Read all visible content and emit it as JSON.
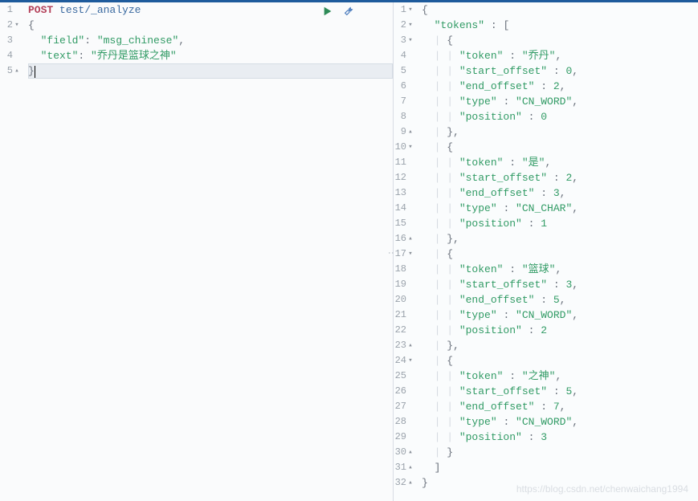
{
  "icons": {
    "run": "run-icon",
    "wrench": "wrench-icon"
  },
  "watermark": "https://blog.csdn.net/chenwaichang1994",
  "request": {
    "gutter": [
      {
        "n": "1",
        "fold": ""
      },
      {
        "n": "2",
        "fold": "▾"
      },
      {
        "n": "3",
        "fold": ""
      },
      {
        "n": "4",
        "fold": ""
      },
      {
        "n": "5",
        "fold": "▴"
      }
    ],
    "lines": [
      [
        {
          "t": "POST ",
          "c": "kw-method"
        },
        {
          "t": "test/_analyze",
          "c": "kw-path"
        }
      ],
      [
        {
          "t": "{",
          "c": "brace"
        }
      ],
      [
        {
          "t": "  ",
          "c": ""
        },
        {
          "t": "\"field\"",
          "c": "key"
        },
        {
          "t": ": ",
          "c": "colon"
        },
        {
          "t": "\"msg_chinese\"",
          "c": "str"
        },
        {
          "t": ",",
          "c": "punct"
        }
      ],
      [
        {
          "t": "  ",
          "c": ""
        },
        {
          "t": "\"text\"",
          "c": "key"
        },
        {
          "t": ": ",
          "c": "colon"
        },
        {
          "t": "\"乔丹是篮球之神\"",
          "c": "str"
        }
      ],
      [
        {
          "t": "}",
          "c": "brace"
        },
        {
          "t": "|",
          "c": "cursor-mark"
        }
      ]
    ]
  },
  "response": {
    "gutter": [
      {
        "n": "1",
        "fold": "▾"
      },
      {
        "n": "2",
        "fold": "▾"
      },
      {
        "n": "3",
        "fold": "▾"
      },
      {
        "n": "4",
        "fold": ""
      },
      {
        "n": "5",
        "fold": ""
      },
      {
        "n": "6",
        "fold": ""
      },
      {
        "n": "7",
        "fold": ""
      },
      {
        "n": "8",
        "fold": ""
      },
      {
        "n": "9",
        "fold": "▴"
      },
      {
        "n": "10",
        "fold": "▾"
      },
      {
        "n": "11",
        "fold": ""
      },
      {
        "n": "12",
        "fold": ""
      },
      {
        "n": "13",
        "fold": ""
      },
      {
        "n": "14",
        "fold": ""
      },
      {
        "n": "15",
        "fold": ""
      },
      {
        "n": "16",
        "fold": "▴"
      },
      {
        "n": "17",
        "fold": "▾"
      },
      {
        "n": "18",
        "fold": ""
      },
      {
        "n": "19",
        "fold": ""
      },
      {
        "n": "20",
        "fold": ""
      },
      {
        "n": "21",
        "fold": ""
      },
      {
        "n": "22",
        "fold": ""
      },
      {
        "n": "23",
        "fold": "▴"
      },
      {
        "n": "24",
        "fold": "▾"
      },
      {
        "n": "25",
        "fold": ""
      },
      {
        "n": "26",
        "fold": ""
      },
      {
        "n": "27",
        "fold": ""
      },
      {
        "n": "28",
        "fold": ""
      },
      {
        "n": "29",
        "fold": ""
      },
      {
        "n": "30",
        "fold": "▴"
      },
      {
        "n": "31",
        "fold": "▴"
      },
      {
        "n": "32",
        "fold": "▴"
      }
    ],
    "lines": [
      [
        {
          "t": "{",
          "c": "brace"
        }
      ],
      [
        {
          "t": "  ",
          "c": ""
        },
        {
          "t": "\"tokens\"",
          "c": "key"
        },
        {
          "t": " : ",
          "c": "colon"
        },
        {
          "t": "[",
          "c": "brace"
        }
      ],
      [
        {
          "t": "  ",
          "c": ""
        },
        {
          "t": "| ",
          "c": "guide"
        },
        {
          "t": "{",
          "c": "brace"
        }
      ],
      [
        {
          "t": "  ",
          "c": ""
        },
        {
          "t": "| | ",
          "c": "guide"
        },
        {
          "t": "\"token\"",
          "c": "key"
        },
        {
          "t": " : ",
          "c": "colon"
        },
        {
          "t": "\"乔丹\"",
          "c": "str"
        },
        {
          "t": ",",
          "c": "punct"
        }
      ],
      [
        {
          "t": "  ",
          "c": ""
        },
        {
          "t": "| | ",
          "c": "guide"
        },
        {
          "t": "\"start_offset\"",
          "c": "key"
        },
        {
          "t": " : ",
          "c": "colon"
        },
        {
          "t": "0",
          "c": "num"
        },
        {
          "t": ",",
          "c": "punct"
        }
      ],
      [
        {
          "t": "  ",
          "c": ""
        },
        {
          "t": "| | ",
          "c": "guide"
        },
        {
          "t": "\"end_offset\"",
          "c": "key"
        },
        {
          "t": " : ",
          "c": "colon"
        },
        {
          "t": "2",
          "c": "num"
        },
        {
          "t": ",",
          "c": "punct"
        }
      ],
      [
        {
          "t": "  ",
          "c": ""
        },
        {
          "t": "| | ",
          "c": "guide"
        },
        {
          "t": "\"type\"",
          "c": "key"
        },
        {
          "t": " : ",
          "c": "colon"
        },
        {
          "t": "\"CN_WORD\"",
          "c": "str"
        },
        {
          "t": ",",
          "c": "punct"
        }
      ],
      [
        {
          "t": "  ",
          "c": ""
        },
        {
          "t": "| | ",
          "c": "guide"
        },
        {
          "t": "\"position\"",
          "c": "key"
        },
        {
          "t": " : ",
          "c": "colon"
        },
        {
          "t": "0",
          "c": "num"
        }
      ],
      [
        {
          "t": "  ",
          "c": ""
        },
        {
          "t": "| ",
          "c": "guide"
        },
        {
          "t": "}",
          "c": "brace"
        },
        {
          "t": ",",
          "c": "punct"
        }
      ],
      [
        {
          "t": "  ",
          "c": ""
        },
        {
          "t": "| ",
          "c": "guide"
        },
        {
          "t": "{",
          "c": "brace"
        }
      ],
      [
        {
          "t": "  ",
          "c": ""
        },
        {
          "t": "| | ",
          "c": "guide"
        },
        {
          "t": "\"token\"",
          "c": "key"
        },
        {
          "t": " : ",
          "c": "colon"
        },
        {
          "t": "\"是\"",
          "c": "str"
        },
        {
          "t": ",",
          "c": "punct"
        }
      ],
      [
        {
          "t": "  ",
          "c": ""
        },
        {
          "t": "| | ",
          "c": "guide"
        },
        {
          "t": "\"start_offset\"",
          "c": "key"
        },
        {
          "t": " : ",
          "c": "colon"
        },
        {
          "t": "2",
          "c": "num"
        },
        {
          "t": ",",
          "c": "punct"
        }
      ],
      [
        {
          "t": "  ",
          "c": ""
        },
        {
          "t": "| | ",
          "c": "guide"
        },
        {
          "t": "\"end_offset\"",
          "c": "key"
        },
        {
          "t": " : ",
          "c": "colon"
        },
        {
          "t": "3",
          "c": "num"
        },
        {
          "t": ",",
          "c": "punct"
        }
      ],
      [
        {
          "t": "  ",
          "c": ""
        },
        {
          "t": "| | ",
          "c": "guide"
        },
        {
          "t": "\"type\"",
          "c": "key"
        },
        {
          "t": " : ",
          "c": "colon"
        },
        {
          "t": "\"CN_CHAR\"",
          "c": "str"
        },
        {
          "t": ",",
          "c": "punct"
        }
      ],
      [
        {
          "t": "  ",
          "c": ""
        },
        {
          "t": "| | ",
          "c": "guide"
        },
        {
          "t": "\"position\"",
          "c": "key"
        },
        {
          "t": " : ",
          "c": "colon"
        },
        {
          "t": "1",
          "c": "num"
        }
      ],
      [
        {
          "t": "  ",
          "c": ""
        },
        {
          "t": "| ",
          "c": "guide"
        },
        {
          "t": "}",
          "c": "brace"
        },
        {
          "t": ",",
          "c": "punct"
        }
      ],
      [
        {
          "t": "  ",
          "c": ""
        },
        {
          "t": "| ",
          "c": "guide"
        },
        {
          "t": "{",
          "c": "brace"
        }
      ],
      [
        {
          "t": "  ",
          "c": ""
        },
        {
          "t": "| | ",
          "c": "guide"
        },
        {
          "t": "\"token\"",
          "c": "key"
        },
        {
          "t": " : ",
          "c": "colon"
        },
        {
          "t": "\"篮球\"",
          "c": "str"
        },
        {
          "t": ",",
          "c": "punct"
        }
      ],
      [
        {
          "t": "  ",
          "c": ""
        },
        {
          "t": "| | ",
          "c": "guide"
        },
        {
          "t": "\"start_offset\"",
          "c": "key"
        },
        {
          "t": " : ",
          "c": "colon"
        },
        {
          "t": "3",
          "c": "num"
        },
        {
          "t": ",",
          "c": "punct"
        }
      ],
      [
        {
          "t": "  ",
          "c": ""
        },
        {
          "t": "| | ",
          "c": "guide"
        },
        {
          "t": "\"end_offset\"",
          "c": "key"
        },
        {
          "t": " : ",
          "c": "colon"
        },
        {
          "t": "5",
          "c": "num"
        },
        {
          "t": ",",
          "c": "punct"
        }
      ],
      [
        {
          "t": "  ",
          "c": ""
        },
        {
          "t": "| | ",
          "c": "guide"
        },
        {
          "t": "\"type\"",
          "c": "key"
        },
        {
          "t": " : ",
          "c": "colon"
        },
        {
          "t": "\"CN_WORD\"",
          "c": "str"
        },
        {
          "t": ",",
          "c": "punct"
        }
      ],
      [
        {
          "t": "  ",
          "c": ""
        },
        {
          "t": "| | ",
          "c": "guide"
        },
        {
          "t": "\"position\"",
          "c": "key"
        },
        {
          "t": " : ",
          "c": "colon"
        },
        {
          "t": "2",
          "c": "num"
        }
      ],
      [
        {
          "t": "  ",
          "c": ""
        },
        {
          "t": "| ",
          "c": "guide"
        },
        {
          "t": "}",
          "c": "brace"
        },
        {
          "t": ",",
          "c": "punct"
        }
      ],
      [
        {
          "t": "  ",
          "c": ""
        },
        {
          "t": "| ",
          "c": "guide"
        },
        {
          "t": "{",
          "c": "brace"
        }
      ],
      [
        {
          "t": "  ",
          "c": ""
        },
        {
          "t": "| | ",
          "c": "guide"
        },
        {
          "t": "\"token\"",
          "c": "key"
        },
        {
          "t": " : ",
          "c": "colon"
        },
        {
          "t": "\"之神\"",
          "c": "str"
        },
        {
          "t": ",",
          "c": "punct"
        }
      ],
      [
        {
          "t": "  ",
          "c": ""
        },
        {
          "t": "| | ",
          "c": "guide"
        },
        {
          "t": "\"start_offset\"",
          "c": "key"
        },
        {
          "t": " : ",
          "c": "colon"
        },
        {
          "t": "5",
          "c": "num"
        },
        {
          "t": ",",
          "c": "punct"
        }
      ],
      [
        {
          "t": "  ",
          "c": ""
        },
        {
          "t": "| | ",
          "c": "guide"
        },
        {
          "t": "\"end_offset\"",
          "c": "key"
        },
        {
          "t": " : ",
          "c": "colon"
        },
        {
          "t": "7",
          "c": "num"
        },
        {
          "t": ",",
          "c": "punct"
        }
      ],
      [
        {
          "t": "  ",
          "c": ""
        },
        {
          "t": "| | ",
          "c": "guide"
        },
        {
          "t": "\"type\"",
          "c": "key"
        },
        {
          "t": " : ",
          "c": "colon"
        },
        {
          "t": "\"CN_WORD\"",
          "c": "str"
        },
        {
          "t": ",",
          "c": "punct"
        }
      ],
      [
        {
          "t": "  ",
          "c": ""
        },
        {
          "t": "| | ",
          "c": "guide"
        },
        {
          "t": "\"position\"",
          "c": "key"
        },
        {
          "t": " : ",
          "c": "colon"
        },
        {
          "t": "3",
          "c": "num"
        }
      ],
      [
        {
          "t": "  ",
          "c": ""
        },
        {
          "t": "| ",
          "c": "guide"
        },
        {
          "t": "}",
          "c": "brace"
        }
      ],
      [
        {
          "t": "  ",
          "c": ""
        },
        {
          "t": "]",
          "c": "brace"
        }
      ],
      [
        {
          "t": "}",
          "c": "brace"
        }
      ]
    ]
  },
  "chart_data": {
    "type": "table",
    "title": "Elasticsearch _analyze response tokens",
    "columns": [
      "token",
      "start_offset",
      "end_offset",
      "type",
      "position"
    ],
    "rows": [
      [
        "乔丹",
        0,
        2,
        "CN_WORD",
        0
      ],
      [
        "是",
        2,
        3,
        "CN_CHAR",
        1
      ],
      [
        "篮球",
        3,
        5,
        "CN_WORD",
        2
      ],
      [
        "之神",
        5,
        7,
        "CN_WORD",
        3
      ]
    ]
  }
}
